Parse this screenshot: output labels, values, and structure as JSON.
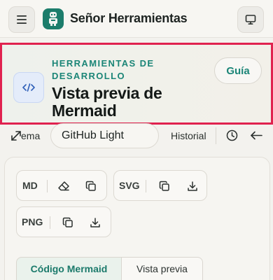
{
  "app": {
    "title": "Señor Herramientas",
    "icons": {
      "menu": "menu-icon",
      "logo": "robot-logo-icon",
      "display": "monitor-icon"
    }
  },
  "hero": {
    "eyebrow": "HERRAMIENTAS DE DESARROLLO",
    "title": "Vista previa de Mermaid",
    "guide_label": "Guía",
    "icon": "code-icon",
    "accent_color": "#1b8577",
    "highlight_color": "#e0224f"
  },
  "toolbar": {
    "theme_label": "ema",
    "theme_value": "GitHub Light",
    "history_label": "Historial",
    "icons": [
      "expand-icon",
      "clock-icon",
      "arrow-left-icon"
    ]
  },
  "exports": {
    "md_label": "MD",
    "svg_label": "SVG",
    "png_label": "PNG"
  },
  "tabs": {
    "code_label": "Código Mermaid",
    "preview_label": "Vista previa",
    "active": "Código Mermaid"
  }
}
